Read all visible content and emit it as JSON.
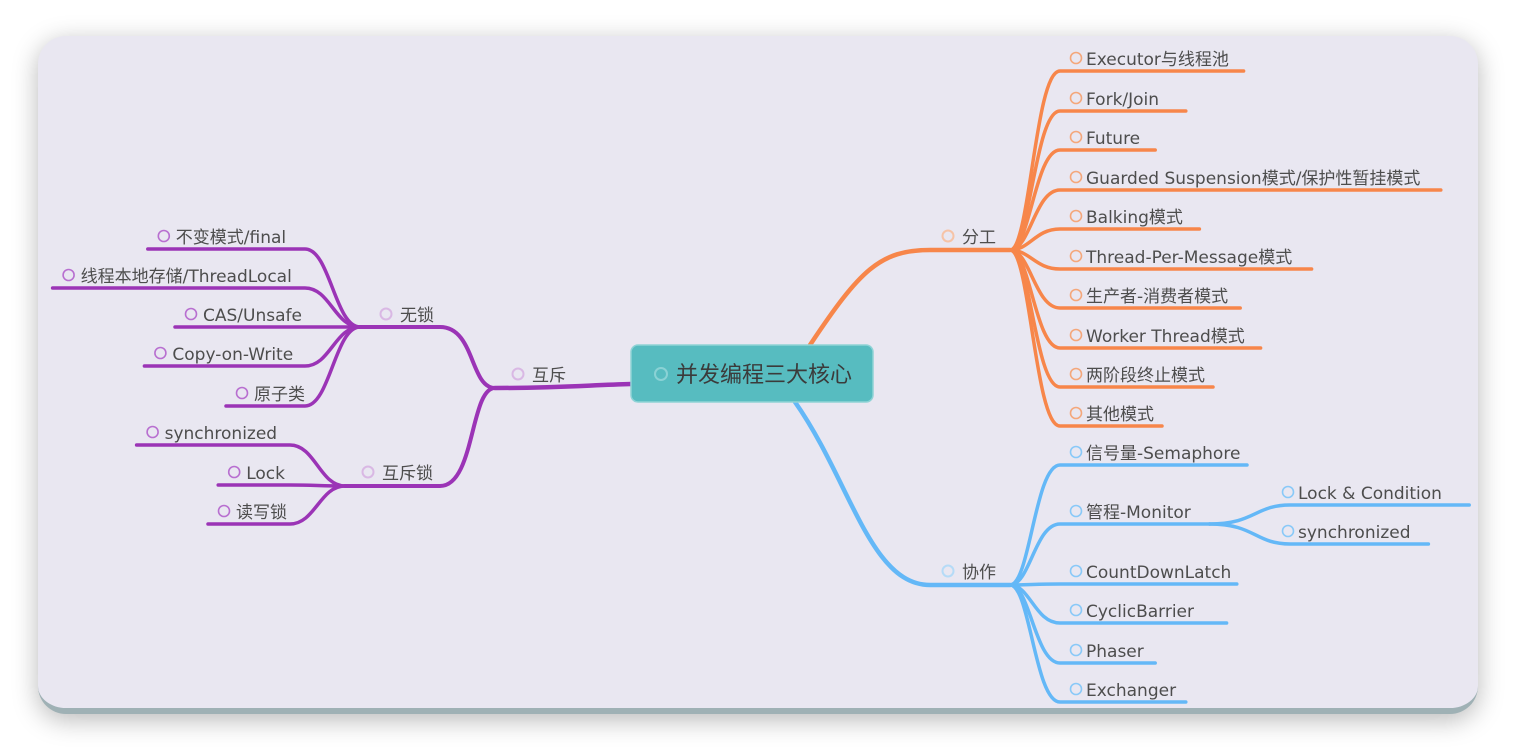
{
  "mindmap": {
    "root": {
      "label": "并发编程三大核心",
      "color": "#57bcc0"
    },
    "branches": {
      "fengong": {
        "label": "分工",
        "color": "#f7864a",
        "children": [
          "Executor与线程池",
          "Fork/Join",
          "Future",
          "Guarded Suspension模式/保护性暂挂模式",
          "Balking模式",
          "Thread-Per-Message模式",
          "生产者-消费者模式",
          "Worker Thread模式",
          "两阶段终止模式",
          "其他模式"
        ]
      },
      "xiezuo": {
        "label": "协作",
        "color": "#64b8f7",
        "children": [
          {
            "label": "信号量-Semaphore"
          },
          {
            "label": "管程-Monitor",
            "children": [
              "Lock & Condition",
              "synchronized"
            ]
          },
          {
            "label": "CountDownLatch"
          },
          {
            "label": "CyclicBarrier"
          },
          {
            "label": "Phaser"
          },
          {
            "label": "Exchanger"
          }
        ]
      },
      "huchi": {
        "label": "互斥",
        "color": "#9b34b6",
        "children": [
          {
            "label": "无锁",
            "children": [
              "不变模式/final",
              "线程本地存储/ThreadLocal",
              "CAS/Unsafe",
              "Copy-on-Write",
              "原子类"
            ]
          },
          {
            "label": "互斥锁",
            "children": [
              "synchronized",
              "Lock",
              "读写锁"
            ]
          }
        ]
      }
    }
  }
}
